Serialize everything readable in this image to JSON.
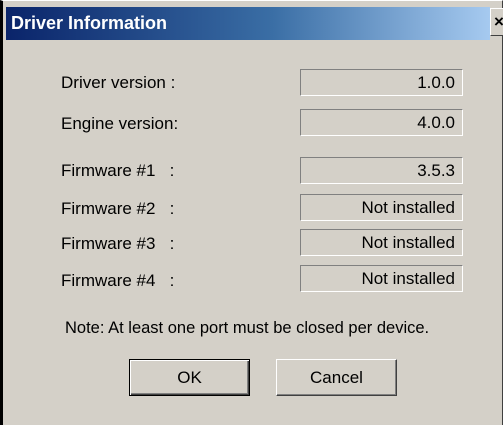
{
  "window": {
    "title": "Driver Information",
    "close_glyph": "✕"
  },
  "fields": [
    {
      "label": "Driver version :",
      "value": "1.0.0"
    },
    {
      "label": "Engine version:",
      "value": "4.0.0"
    },
    {
      "label": "Firmware #1   :",
      "value": "3.5.3"
    },
    {
      "label": "Firmware #2   :",
      "value": "Not installed"
    },
    {
      "label": "Firmware #3   :",
      "value": "Not installed"
    },
    {
      "label": "Firmware #4   :",
      "value": "Not installed"
    }
  ],
  "note": "Note: At least one port must be closed per device.",
  "buttons": {
    "ok": "OK",
    "cancel": "Cancel"
  }
}
